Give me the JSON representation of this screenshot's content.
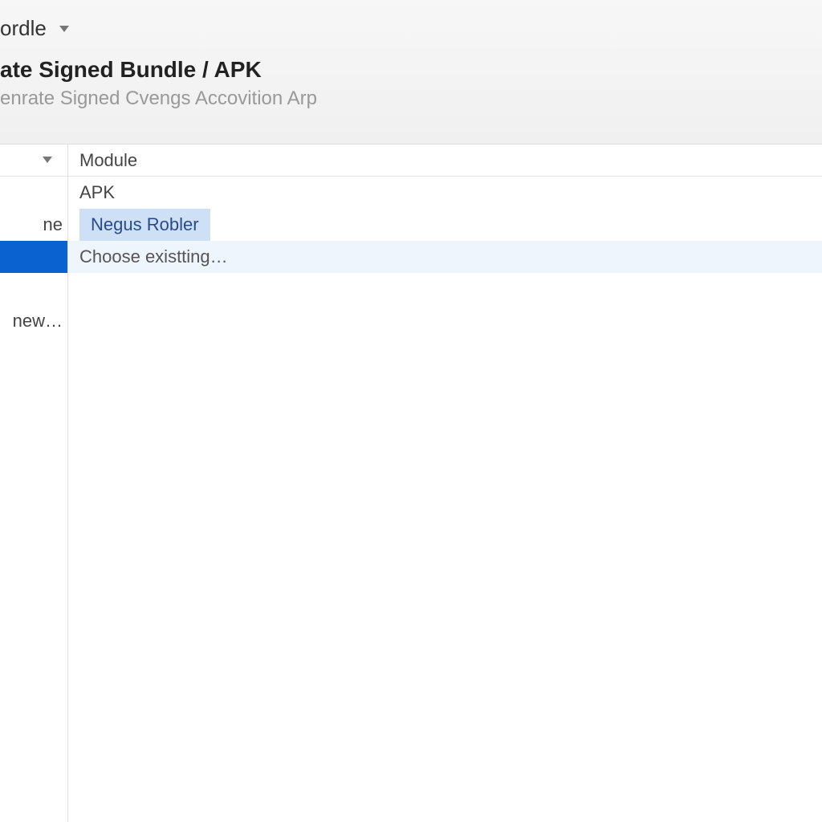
{
  "project": {
    "name": "ordle"
  },
  "dialog": {
    "title": "ate Signed Bundle / APK",
    "subtitle": "enrate Signed Cvengs Accovition Arp"
  },
  "sidebar": {
    "items": [
      {
        "label": ""
      },
      {
        "label": "ne"
      },
      {
        "label": ""
      },
      {
        "label": ""
      },
      {
        "label": "new…"
      }
    ]
  },
  "main": {
    "header": "Module",
    "rows": [
      {
        "label": "APK",
        "state": "normal"
      },
      {
        "label": "Negus Robler",
        "state": "highlighted"
      },
      {
        "label": "Choose existting…",
        "state": "soft"
      }
    ]
  }
}
